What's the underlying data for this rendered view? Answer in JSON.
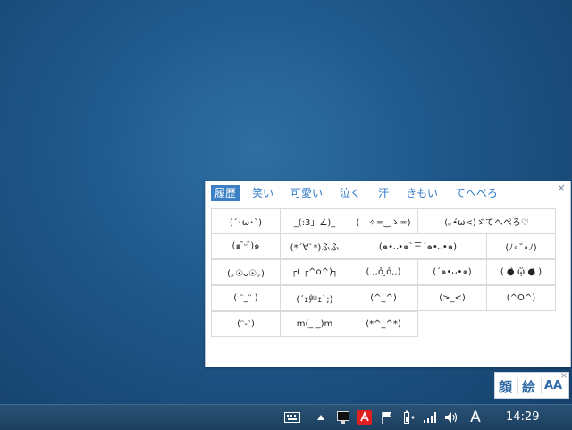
{
  "panel": {
    "close_glyph": "×",
    "tabs": [
      "履歴",
      "笑い",
      "可愛い",
      "泣く",
      "汗",
      "きもい",
      "てへぺろ"
    ],
    "rows": [
      [
        "(´･ω･`)",
        "_(:3」∠)_",
        "(　✧≖‿ゝ≖)",
        "(｡•́ω<)ゞてへぺろ♡"
      ],
      [
        "(๑ ̄ᵕ ̄)๑",
        "(*´∀`*)ふふ",
        "(๑•᎑•๑`三´๑•᎑•๑)",
        "(ﾉ∘˘∘ﾉ)"
      ],
      [
        "(｡☉ᴗ☉｡)",
        "┌( ┌^o^)┐",
        "( ,,ỏ ̮ỏ,,)",
        "(´๑•ᴗ•๑)",
        "( ●̀ ᾥ ●́ )"
      ],
      [
        "( ᵔ_ᵔ )",
        "(´ｪ艸ｪ`;)",
        "(^_^)",
        "(>_<)",
        "(^O^)"
      ],
      [
        "(ᵔ-ᵔ)",
        "m(_ _)m",
        "(*^_^*)"
      ]
    ]
  },
  "ime": {
    "kao": "顔",
    "e": "絵",
    "aa": "AA",
    "close_glyph": "×"
  },
  "taskbar": {
    "ime_mode": "A",
    "clock": "14:29"
  }
}
